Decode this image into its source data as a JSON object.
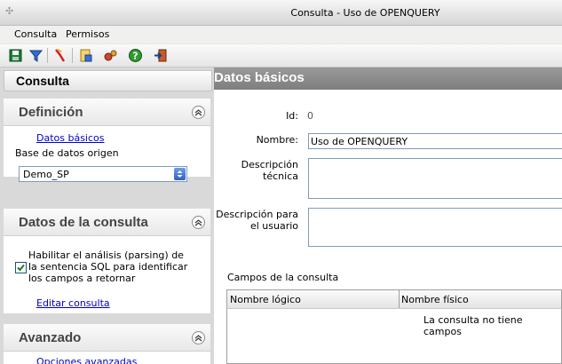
{
  "window": {
    "title": "Consulta - Uso de OPENQUERY"
  },
  "menu": {
    "items": [
      "Consulta",
      "Permisos"
    ]
  },
  "toolbar": {
    "icons": [
      "save-icon",
      "filter-icon",
      "wand-icon",
      "document-icon",
      "gears-icon",
      "help-icon",
      "exit-icon"
    ]
  },
  "left_panel": {
    "header": "Consulta",
    "sections": [
      {
        "title": "Definición",
        "link": "Datos básicos",
        "db_label": "Base de datos origen",
        "db_value": "Demo_SP"
      },
      {
        "title": "Datos de la consulta",
        "checkbox_label": "Habilitar el análisis (parsing) de la sentencia SQL para identificar los campos a retornar",
        "checkbox_checked": true,
        "link": "Editar consulta"
      },
      {
        "title": "Avanzado",
        "link": "Opciones avanzadas"
      }
    ]
  },
  "main": {
    "header": "Datos básicos",
    "id_label": "Id:",
    "id_value": "0",
    "name_label": "Nombre:",
    "name_value": "Uso de OPENQUERY",
    "tech_desc_label": "Descripción técnica",
    "tech_desc_value": "",
    "user_desc_label": "Descripción para el usuario",
    "user_desc_value": "",
    "fields_label": "Campos de la consulta",
    "columns": [
      "Nombre lógico",
      "Nombre físico"
    ],
    "empty_text": "La consulta no tiene campos"
  }
}
